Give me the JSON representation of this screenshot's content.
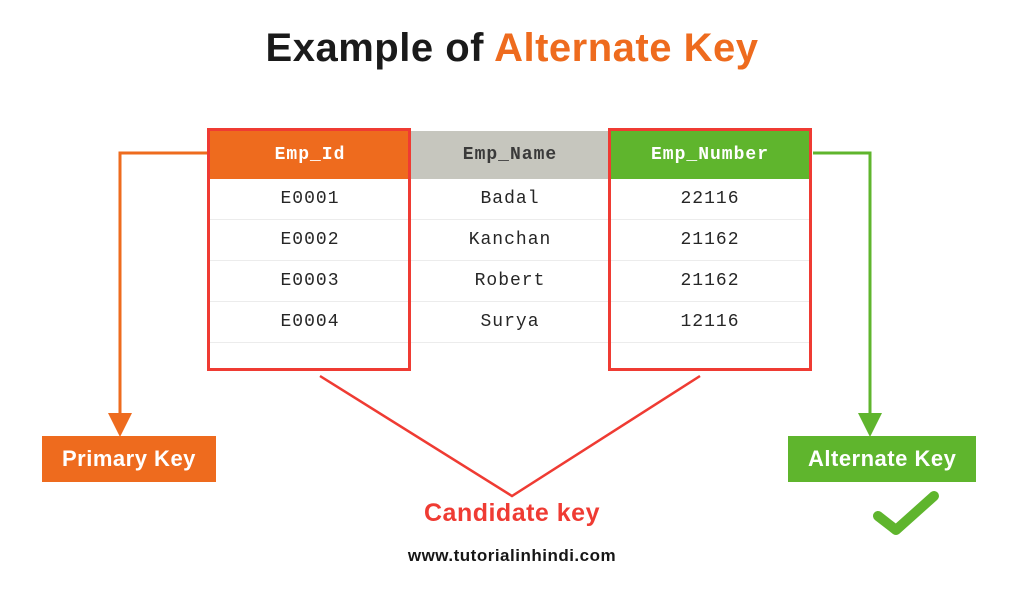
{
  "title": {
    "part1": "Example of ",
    "part2": "Alternate Key"
  },
  "table": {
    "headers": [
      "Emp_Id",
      "Emp_Name",
      "Emp_Number"
    ],
    "rows": [
      [
        "E0001",
        "Badal",
        "22116"
      ],
      [
        "E0002",
        "Kanchan",
        "21162"
      ],
      [
        "E0003",
        "Robert",
        "21162"
      ],
      [
        "E0004",
        "Surya",
        "12116"
      ]
    ]
  },
  "labels": {
    "primary_key": "Primary Key",
    "alternate_key": "Alternate Key",
    "candidate_key": "Candidate key"
  },
  "footer": "www.tutorialinhindi.com",
  "colors": {
    "orange": "#ee6b1e",
    "green": "#5fb52d",
    "red": "#ef3b33",
    "grey": "#c6c6be"
  }
}
